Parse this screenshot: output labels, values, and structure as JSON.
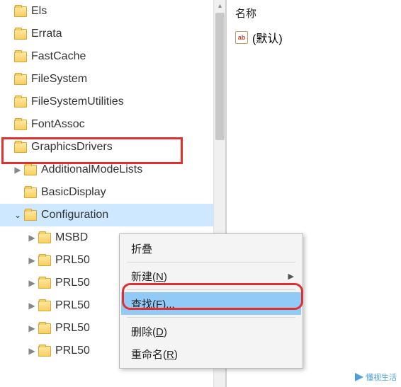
{
  "tree": {
    "items": [
      {
        "label": "Els",
        "expander": null,
        "depth": 0
      },
      {
        "label": "Errata",
        "expander": null,
        "depth": 0
      },
      {
        "label": "FastCache",
        "expander": null,
        "depth": 0
      },
      {
        "label": "FileSystem",
        "expander": null,
        "depth": 0
      },
      {
        "label": "FileSystemUtilities",
        "expander": null,
        "depth": 0
      },
      {
        "label": "FontAssoc",
        "expander": null,
        "depth": 0
      },
      {
        "label": "GraphicsDrivers",
        "expander": null,
        "depth": 0
      },
      {
        "label": "AdditionalModeLists",
        "expander": ">",
        "depth": 1
      },
      {
        "label": "BasicDisplay",
        "expander": null,
        "depth": 1
      },
      {
        "label": "Configuration",
        "expander": "v",
        "depth": 1,
        "selected": true
      },
      {
        "label": "MSBD",
        "expander": ">",
        "depth": 2
      },
      {
        "label": "PRL50",
        "expander": ">",
        "depth": 2
      },
      {
        "label": "PRL50",
        "expander": ">",
        "depth": 2
      },
      {
        "label": "PRL50",
        "expander": ">",
        "depth": 2
      },
      {
        "label": "PRL50",
        "expander": ">",
        "depth": 2
      },
      {
        "label": "PRL50",
        "expander": ">",
        "depth": 2
      }
    ]
  },
  "right": {
    "header": "名称",
    "default_value": "(默认)",
    "ab": "ab"
  },
  "context_menu": {
    "collapse": "折叠",
    "new": "新建",
    "new_key": "N",
    "find": "查找",
    "find_key": "F",
    "find_suffix": "...",
    "delete": "删除",
    "delete_key": "D",
    "rename": "重命名",
    "rename_key": "R"
  },
  "watermark": "懂视生活"
}
